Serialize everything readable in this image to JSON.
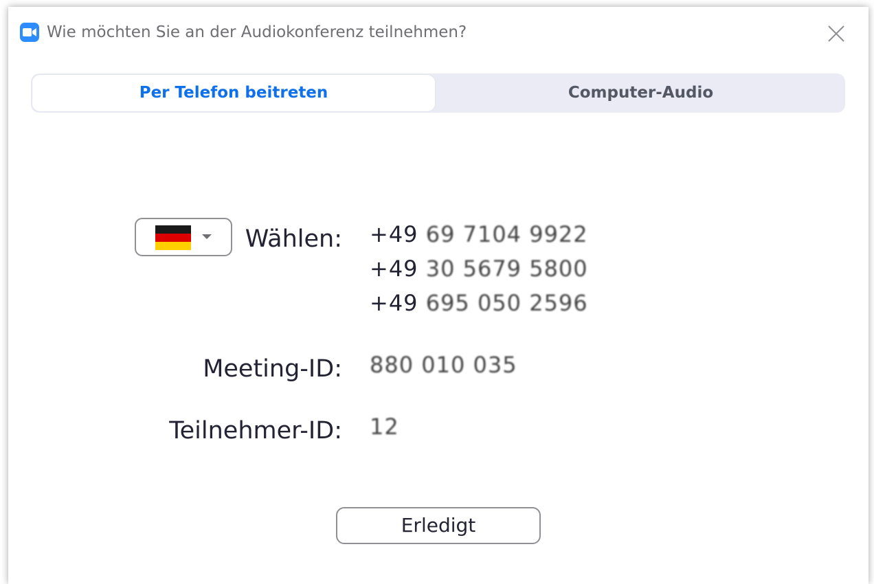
{
  "window": {
    "title": "Wie möchten Sie an der Audiokonferenz teilnehmen?",
    "app_icon": "zoom-camera-icon",
    "close_icon": "close-icon"
  },
  "tabs": [
    {
      "label": "Per Telefon beitreten",
      "active": true
    },
    {
      "label": "Computer-Audio",
      "active": false
    }
  ],
  "colors": {
    "accent": "#0E71EB",
    "app_icon_bg": "#2D8CFF",
    "tab_bar_bg": "#EAEBF5"
  },
  "phone": {
    "country": "Deutschland",
    "flag_icon": "germany-flag-icon",
    "dial_label": "Wählen:",
    "numbers": [
      {
        "prefix": "+49",
        "number": "69 7104 9922"
      },
      {
        "prefix": "+49",
        "number": "30 5679 5800"
      },
      {
        "prefix": "+49",
        "number": "695 050 2596"
      }
    ],
    "meeting_id_label": "Meeting-ID:",
    "meeting_id": "880 010 035",
    "participant_id_label": "Teilnehmer-ID:",
    "participant_id": "12"
  },
  "footer": {
    "done_label": "Erledigt"
  }
}
